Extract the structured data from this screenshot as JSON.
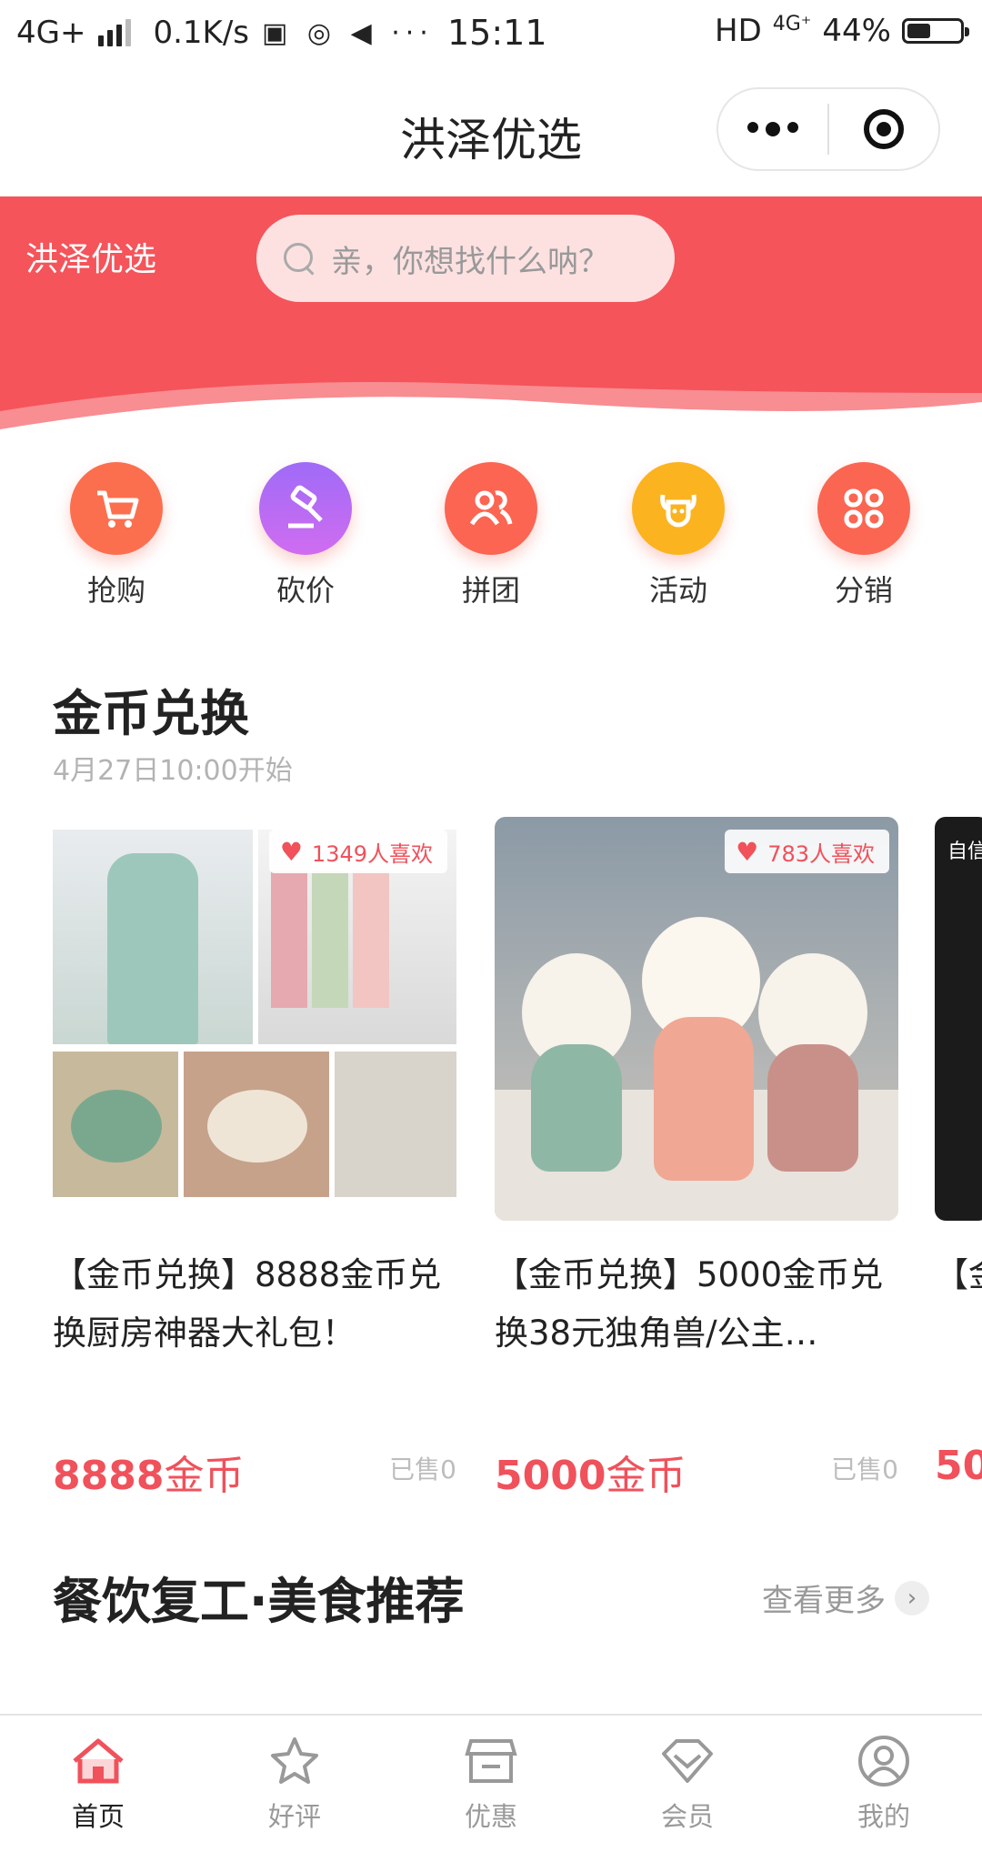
{
  "status_bar": {
    "network": "4G+",
    "speed": "0.1K/s",
    "time": "15:11",
    "hd": "HD",
    "net2": "4G⁺",
    "battery": "44%",
    "battery_level": 0.44
  },
  "navbar": {
    "title": "洪泽优选"
  },
  "header": {
    "brand": "洪泽优选",
    "search_placeholder": "亲，你想找什么呐？"
  },
  "quick_actions": [
    {
      "label": "抢购",
      "icon": "cart-icon",
      "color": "#fb6f4f"
    },
    {
      "label": "砍价",
      "icon": "hammer-icon",
      "color": "#b56cf5"
    },
    {
      "label": "拼团",
      "icon": "group-icon",
      "color": "#fb6552"
    },
    {
      "label": "活动",
      "icon": "activity-icon",
      "color": "#fbb31f"
    },
    {
      "label": "分销",
      "icon": "grid-icon",
      "color": "#fb6652"
    }
  ],
  "coin_section": {
    "title": "金币兑换",
    "subtitle": "4月27日10:00开始",
    "products": [
      {
        "likes": "1349人喜欢",
        "name": "【金币兑换】8888金币兑换厨房神器大礼包！",
        "price_num": "8888",
        "price_unit": "金币",
        "sold": "已售0"
      },
      {
        "likes": "783人喜欢",
        "name": "【金币兑换】5000金币兑换38元独角兽/公主…",
        "price_num": "5000",
        "price_unit": "金币",
        "sold": "已售0"
      },
      {
        "likes": "",
        "name": "【金",
        "price_num": "50",
        "price_unit": "",
        "sold": ""
      }
    ]
  },
  "food_section": {
    "title": "餐饮复工·美食推荐",
    "more": "查看更多"
  },
  "tabs": [
    {
      "label": "首页",
      "icon": "home-icon",
      "active": true
    },
    {
      "label": "好评",
      "icon": "star-icon",
      "active": false
    },
    {
      "label": "优惠",
      "icon": "shop-icon",
      "active": false
    },
    {
      "label": "会员",
      "icon": "diamond-icon",
      "active": false
    },
    {
      "label": "我的",
      "icon": "user-icon",
      "active": false
    }
  ],
  "colors": {
    "brand": "#f4545a",
    "price": "#f0515b"
  }
}
